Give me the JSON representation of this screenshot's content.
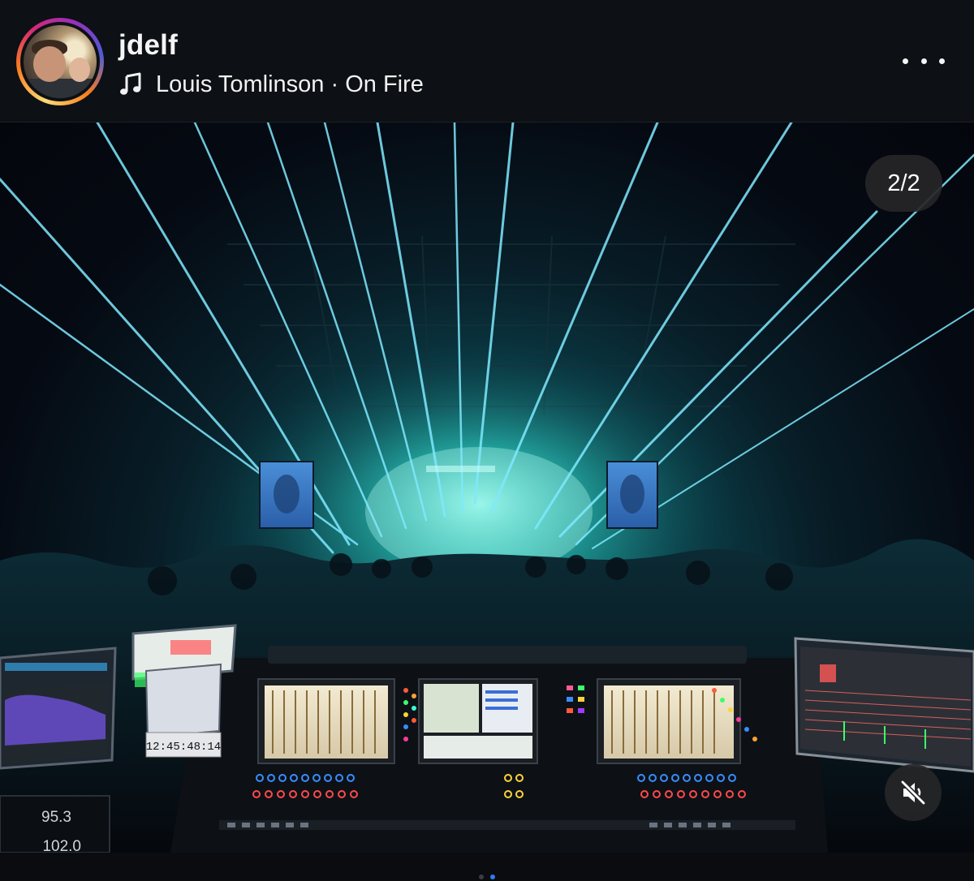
{
  "post_header": {
    "username": "jdelf",
    "music_artist": "Louis Tomlinson",
    "music_separator": " · ",
    "music_title": "On Fire",
    "avatar_icon": "user-avatar",
    "music_icon": "music-note-icon",
    "more_icon": "more-options-icon"
  },
  "media": {
    "counter": "2/2",
    "mute_icon": "speaker-muted-icon",
    "console_readouts": {
      "timecode": "12:45:48:14",
      "level_1": "95.3",
      "level_2": "102.0"
    },
    "accent_laser": "#7fe9ff",
    "accent_glow": "#2fe0d0"
  },
  "carousel": {
    "current": 2,
    "total": 2
  }
}
